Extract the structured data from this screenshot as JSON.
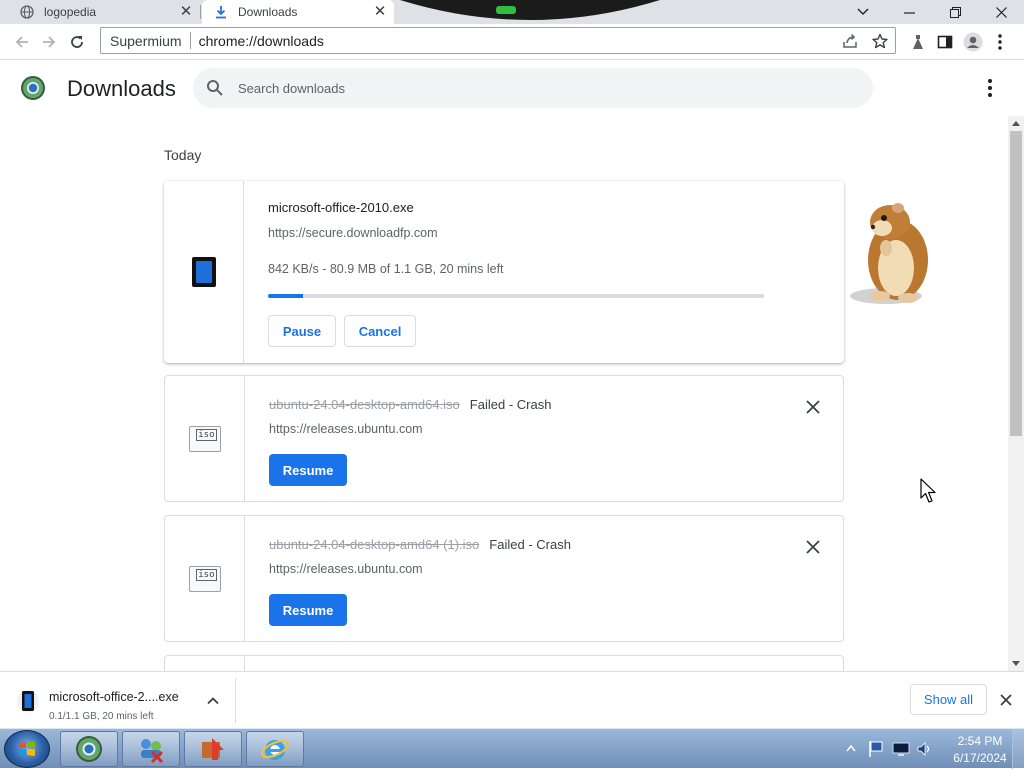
{
  "tabs": [
    {
      "title": "logopedia",
      "icon": "globe-icon"
    },
    {
      "title": "Downloads",
      "icon": "download-icon"
    }
  ],
  "omnibox": {
    "site_label": "Supermium",
    "url": "chrome://downloads"
  },
  "header": {
    "title": "Downloads",
    "search_placeholder": "Search downloads"
  },
  "section": {
    "label": "Today"
  },
  "downloads": [
    {
      "filename": "microsoft-office-2010.exe",
      "url": "https://secure.downloadfp.com",
      "progress_text": "842 KB/s - 80.9 MB of 1.1 GB, 20 mins left",
      "progress": 0.07,
      "buttons": [
        "Pause",
        "Cancel"
      ],
      "icon": "exe-file-icon"
    },
    {
      "filename": "ubuntu-24.04-desktop-amd64.iso",
      "status": "Failed - Crash",
      "url": "https://releases.ubuntu.com",
      "button": "Resume",
      "icon": "iso-file-icon",
      "icon_text": "iso"
    },
    {
      "filename": "ubuntu-24.04-desktop-amd64 (1).iso",
      "status": "Failed - Crash",
      "url": "https://releases.ubuntu.com",
      "button": "Resume",
      "icon": "iso-file-icon",
      "icon_text": "iso"
    }
  ],
  "shelf": {
    "filename": "microsoft-office-2....exe",
    "status": "0.1/1.1 GB, 20 mins left",
    "show_all": "Show all"
  },
  "taskbar": {
    "time": "2:54 PM",
    "date": "6/17/2024"
  },
  "colors": {
    "accent": "#1a73e8",
    "tabstrip": "#dee1e6",
    "taskbar": "#7f9cc4"
  }
}
